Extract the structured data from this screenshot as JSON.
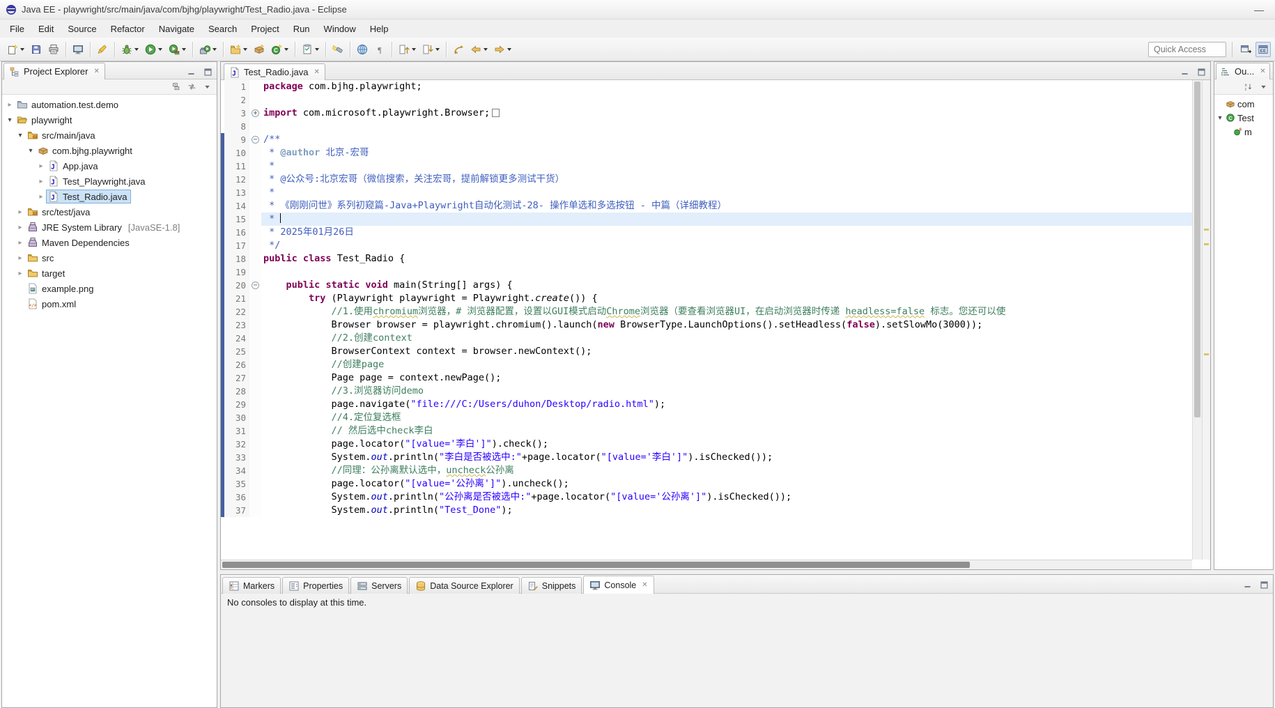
{
  "window": {
    "title": "Java EE - playwright/src/main/java/com/bjhg/playwright/Test_Radio.java - Eclipse",
    "min_glyph": "—"
  },
  "menu": {
    "items": [
      "File",
      "Edit",
      "Source",
      "Refactor",
      "Navigate",
      "Search",
      "Project",
      "Run",
      "Window",
      "Help"
    ]
  },
  "toolbar": {
    "quick_access": "Quick Access",
    "items": [
      {
        "icon": "new-wizard",
        "dd": true
      },
      {
        "icon": "save"
      },
      {
        "icon": "print"
      },
      {
        "sep": true
      },
      {
        "icon": "console-view"
      },
      {
        "sep": true
      },
      {
        "icon": "mark-occurrences"
      },
      {
        "sep": true
      },
      {
        "icon": "debug",
        "dd": true
      },
      {
        "icon": "run",
        "dd": true
      },
      {
        "icon": "coverage",
        "dd": true
      },
      {
        "sep": true
      },
      {
        "icon": "run-external",
        "dd": true
      },
      {
        "sep": true
      },
      {
        "icon": "new-java-project",
        "dd": true
      },
      {
        "icon": "new-package"
      },
      {
        "icon": "new-class",
        "dd": true
      },
      {
        "sep": true
      },
      {
        "icon": "open-task",
        "dd": true
      },
      {
        "sep": true
      },
      {
        "icon": "search"
      },
      {
        "sep": true
      },
      {
        "icon": "web-browser"
      },
      {
        "icon": "show-whitespace"
      },
      {
        "sep": true
      },
      {
        "icon": "previous-annotation",
        "dd": true
      },
      {
        "icon": "next-annotation",
        "dd": true
      },
      {
        "sep": true
      },
      {
        "icon": "last-edit-location"
      },
      {
        "icon": "back",
        "dd": true
      },
      {
        "icon": "forward",
        "dd": true
      }
    ],
    "perspectives": [
      {
        "icon": "open-perspective",
        "active": false
      },
      {
        "icon": "javaee-perspective",
        "active": true
      }
    ]
  },
  "project_explorer": {
    "title": "Project Explorer",
    "close": "✕",
    "header_icons": [
      "min-view-icon",
      "max-view-icon"
    ],
    "toolbar_icons": [
      "collapse-all-icon",
      "link-editor-icon",
      "view-menu-icon"
    ],
    "tree": [
      {
        "depth": 0,
        "arrow": "col",
        "icon": "project-closed-icon",
        "label": "automation.test.demo"
      },
      {
        "depth": 0,
        "arrow": "exp",
        "icon": "project-open-icon",
        "label": "playwright"
      },
      {
        "depth": 1,
        "arrow": "exp",
        "icon": "src-folder-icon",
        "label": "src/main/java"
      },
      {
        "depth": 2,
        "arrow": "exp",
        "icon": "package-icon",
        "label": "com.bjhg.playwright"
      },
      {
        "depth": 3,
        "arrow": "col",
        "icon": "java-file-icon",
        "label": "App.java"
      },
      {
        "depth": 3,
        "arrow": "col",
        "icon": "java-file-icon",
        "label": "Test_Playwright.java"
      },
      {
        "depth": 3,
        "arrow": "col",
        "icon": "java-file-icon",
        "label": "Test_Radio.java",
        "selected": true
      },
      {
        "depth": 1,
        "arrow": "col",
        "icon": "src-folder-icon",
        "label": "src/test/java"
      },
      {
        "depth": 1,
        "arrow": "col",
        "icon": "library-icon",
        "label": "JRE System Library",
        "sub": "[JavaSE-1.8]"
      },
      {
        "depth": 1,
        "arrow": "col",
        "icon": "library-icon",
        "label": "Maven Dependencies"
      },
      {
        "depth": 1,
        "arrow": "col",
        "icon": "folder-icon",
        "label": "src"
      },
      {
        "depth": 1,
        "arrow": "col",
        "icon": "folder-icon",
        "label": "target"
      },
      {
        "depth": 1,
        "arrow": null,
        "icon": "image-file-icon",
        "label": "example.png"
      },
      {
        "depth": 1,
        "arrow": null,
        "icon": "xml-file-icon",
        "label": "pom.xml"
      }
    ]
  },
  "editor": {
    "tab": {
      "label": "Test_Radio.java",
      "close": "✕"
    },
    "header_icons": [
      "min-view-icon",
      "max-view-icon"
    ],
    "lines": [
      {
        "n": "1",
        "s": [
          [
            "kw",
            "package"
          ],
          [
            "pl",
            " com.bjhg.playwright;"
          ]
        ]
      },
      {
        "n": "2",
        "s": []
      },
      {
        "n": "3",
        "f": "+",
        "fbox": true,
        "s": [
          [
            "kw",
            "import"
          ],
          [
            "pl",
            " com.microsoft.playwright.Browser;"
          ]
        ]
      },
      {
        "n": "8",
        "s": []
      },
      {
        "n": "9",
        "f": "-",
        "cb": true,
        "s": [
          [
            "doc",
            "/**"
          ]
        ]
      },
      {
        "n": "10",
        "cb": true,
        "s": [
          [
            "doc",
            " * "
          ],
          [
            "doctag",
            "@author"
          ],
          [
            "doc",
            " 北京-宏哥"
          ]
        ]
      },
      {
        "n": "11",
        "cb": true,
        "s": [
          [
            "doc",
            " * "
          ]
        ]
      },
      {
        "n": "12",
        "cb": true,
        "s": [
          [
            "doc",
            " * @公众号:北京宏哥（微信搜索，关注宏哥，提前解锁更多测试干货）"
          ]
        ]
      },
      {
        "n": "13",
        "cb": true,
        "s": [
          [
            "doc",
            " * "
          ]
        ]
      },
      {
        "n": "14",
        "cb": true,
        "s": [
          [
            "doc",
            " * 《刚刚问世》系列初窥篇-Java+Playwright自动化测试-28- 操作单选和多选按钮 - 中篇（详细教程）"
          ]
        ]
      },
      {
        "n": "15",
        "cb": true,
        "hl": true,
        "s": [
          [
            "doc",
            " * "
          ]
        ]
      },
      {
        "n": "16",
        "cb": true,
        "s": [
          [
            "doc",
            " * 2025年01月26日"
          ]
        ]
      },
      {
        "n": "17",
        "cb": true,
        "s": [
          [
            "doc",
            " */"
          ]
        ]
      },
      {
        "n": "18",
        "cb": true,
        "s": [
          [
            "kw",
            "public"
          ],
          [
            "pl",
            " "
          ],
          [
            "kw",
            "class"
          ],
          [
            "pl",
            " Test_Radio {"
          ]
        ]
      },
      {
        "n": "19",
        "cb": true,
        "s": []
      },
      {
        "n": "20",
        "f": "-",
        "cb": true,
        "s": [
          [
            "pl",
            "    "
          ],
          [
            "kw",
            "public"
          ],
          [
            "pl",
            " "
          ],
          [
            "kw",
            "static"
          ],
          [
            "pl",
            " "
          ],
          [
            "kw",
            "void"
          ],
          [
            "pl",
            " main(String[] args) {"
          ]
        ]
      },
      {
        "n": "21",
        "cb": true,
        "s": [
          [
            "pl",
            "        "
          ],
          [
            "kw",
            "try"
          ],
          [
            "pl",
            " (Playwright playwright = Playwright."
          ],
          [
            "smeth",
            "create"
          ],
          [
            "pl",
            "()) {"
          ]
        ]
      },
      {
        "n": "22",
        "cb": true,
        "s": [
          [
            "com",
            "            //1.使用"
          ],
          [
            "comu",
            "chromium"
          ],
          [
            "com",
            "浏览器，# 浏览器配置，设置以GUI模式启动"
          ],
          [
            "comu",
            "Chrome"
          ],
          [
            "com",
            "浏览器（要查看浏览器UI，在启动浏览器时传递 "
          ],
          [
            "comu",
            "headless=false"
          ],
          [
            "com",
            " 标志。您还可以使"
          ]
        ]
      },
      {
        "n": "23",
        "cb": true,
        "s": [
          [
            "pl",
            "            Browser browser = playwright.chromium().launch("
          ],
          [
            "kw",
            "new"
          ],
          [
            "pl",
            " BrowserType.LaunchOptions().setHeadless("
          ],
          [
            "kw",
            "false"
          ],
          [
            "pl",
            ").setSlowMo(3000));"
          ]
        ]
      },
      {
        "n": "24",
        "cb": true,
        "s": [
          [
            "com",
            "            //2.创建context"
          ]
        ]
      },
      {
        "n": "25",
        "cb": true,
        "s": [
          [
            "pl",
            "            BrowserContext context = browser.newContext();"
          ]
        ]
      },
      {
        "n": "26",
        "cb": true,
        "s": [
          [
            "com",
            "            //创建page"
          ]
        ]
      },
      {
        "n": "27",
        "cb": true,
        "s": [
          [
            "pl",
            "            Page page = context.newPage();"
          ]
        ]
      },
      {
        "n": "28",
        "cb": true,
        "s": [
          [
            "com",
            "            //3.浏览器访问demo"
          ]
        ]
      },
      {
        "n": "29",
        "cb": true,
        "s": [
          [
            "pl",
            "            page.navigate("
          ],
          [
            "str",
            "\"file:///C:/Users/duhon/Desktop/radio.html\""
          ],
          [
            "pl",
            ");"
          ]
        ]
      },
      {
        "n": "30",
        "cb": true,
        "s": [
          [
            "com",
            "            //4.定位复选框"
          ]
        ]
      },
      {
        "n": "31",
        "cb": true,
        "s": [
          [
            "com",
            "            // 然后选中check李白"
          ]
        ]
      },
      {
        "n": "32",
        "cb": true,
        "s": [
          [
            "pl",
            "            page.locator("
          ],
          [
            "str",
            "\"[value='李白']\""
          ],
          [
            "pl",
            ").check();"
          ]
        ]
      },
      {
        "n": "33",
        "cb": true,
        "s": [
          [
            "pl",
            "            System."
          ],
          [
            "sfield",
            "out"
          ],
          [
            "pl",
            ".println("
          ],
          [
            "str",
            "\"李白是否被选中:\""
          ],
          [
            "pl",
            "+page.locator("
          ],
          [
            "str",
            "\"[value='李白']\""
          ],
          [
            "pl",
            ").isChecked());"
          ]
        ]
      },
      {
        "n": "34",
        "cb": true,
        "s": [
          [
            "com",
            "            //同理：公孙离默认选中，"
          ],
          [
            "comu",
            "uncheck"
          ],
          [
            "com",
            "公孙离"
          ]
        ]
      },
      {
        "n": "35",
        "cb": true,
        "s": [
          [
            "pl",
            "            page.locator("
          ],
          [
            "str",
            "\"[value='公孙离']\""
          ],
          [
            "pl",
            ").uncheck();"
          ]
        ]
      },
      {
        "n": "36",
        "cb": true,
        "s": [
          [
            "pl",
            "            System."
          ],
          [
            "sfield",
            "out"
          ],
          [
            "pl",
            ".println("
          ],
          [
            "str",
            "\"公孙离是否被选中:\""
          ],
          [
            "pl",
            "+page.locator("
          ],
          [
            "str",
            "\"[value='公孙离']\""
          ],
          [
            "pl",
            ").isChecked());"
          ]
        ]
      },
      {
        "n": "37",
        "cb": true,
        "s": [
          [
            "pl",
            "            System."
          ],
          [
            "sfield",
            "out"
          ],
          [
            "pl",
            ".println("
          ],
          [
            "str",
            "\"Test_Done\""
          ],
          [
            "pl",
            ");"
          ]
        ]
      }
    ]
  },
  "outline": {
    "tab_label": "Ou...",
    "close": "✕",
    "toolbar_icons": [
      "sort-icon",
      "view-menu-icon"
    ],
    "items": [
      {
        "depth": 0,
        "arrow": null,
        "icon": "package-icon",
        "label": "com"
      },
      {
        "depth": 0,
        "arrow": "exp",
        "icon": "class-icon",
        "label": "Test"
      },
      {
        "depth": 1,
        "arrow": null,
        "icon": "method-static-icon",
        "label": "m"
      }
    ]
  },
  "bottom": {
    "header_icons": [
      "min-view-icon",
      "max-view-icon"
    ],
    "tabs": [
      {
        "label": "Markers",
        "icon": "markers-icon"
      },
      {
        "label": "Properties",
        "icon": "properties-icon"
      },
      {
        "label": "Servers",
        "icon": "servers-icon"
      },
      {
        "label": "Data Source Explorer",
        "icon": "datasource-icon"
      },
      {
        "label": "Snippets",
        "icon": "snippets-icon"
      },
      {
        "label": "Console",
        "icon": "console-view-icon",
        "active": true,
        "close": "✕"
      }
    ],
    "message": "No consoles to display at this time."
  }
}
